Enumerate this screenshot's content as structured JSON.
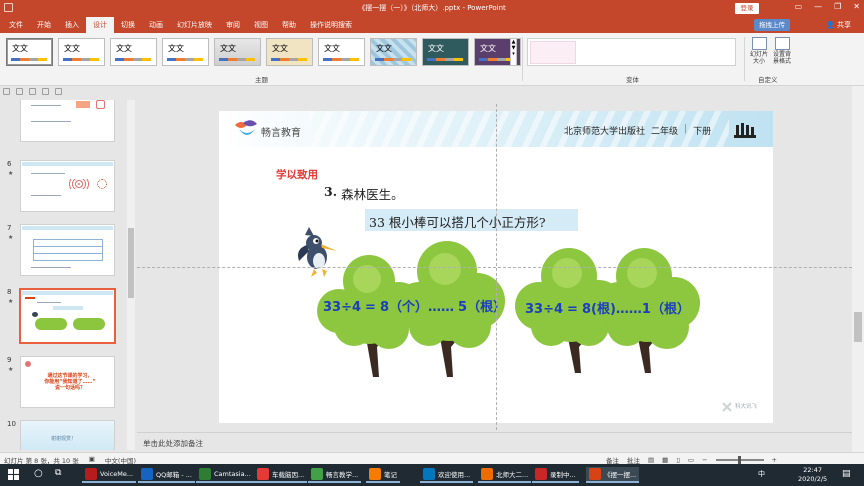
{
  "titlebar": {
    "title": "《摆一摆（一）》（北师大）.pptx - PowerPoint",
    "login": "登录"
  },
  "menu": {
    "items": [
      "文件",
      "开始",
      "插入",
      "设计",
      "切换",
      "动画",
      "幻灯片放映",
      "审阅",
      "视图",
      "帮助",
      "操作说明搜索"
    ],
    "active_index": 3,
    "upload": "拖拽上传",
    "share": "共享"
  },
  "ribbon": {
    "theme_label": "文文",
    "group_theme": "主题",
    "group_variant": "变体",
    "group_custom": "自定义",
    "slide_size": "幻灯片\n大小",
    "format_bg": "设置背\n景格式"
  },
  "slides": [
    {
      "num": "6",
      "star": "★"
    },
    {
      "num": "7",
      "star": "★"
    },
    {
      "num": "8",
      "star": "★"
    },
    {
      "num": "9",
      "star": "★"
    },
    {
      "num": "10",
      "star": ""
    }
  ],
  "thumb9_text": "通过这节课的学习，\n你能用“我知道了……”\n说一句话吗？",
  "thumb10_text": "谢谢观赏！",
  "slide": {
    "brand": "畅言教育",
    "publisher": "北京师范大学出版社",
    "grade": "二年级",
    "term": "下册",
    "section": "学以致用",
    "problem_num": "3.",
    "problem_title": "森林医生。",
    "question": "33 根小棒可以搭几个小正方形?",
    "eq1": {
      "a": "33",
      "op": "÷",
      "b": "4",
      "eq": "=",
      "q": "8",
      "qu": "（个）",
      "dots": "……",
      "r": "5",
      "ru": "（根）"
    },
    "eq2": {
      "a": "33",
      "op": "÷",
      "b": "4",
      "eq": "=",
      "q": "8",
      "qu": "(根)",
      "dots": "……",
      "r": "1",
      "ru": "（根）"
    },
    "watermark": "科大讯飞"
  },
  "notes": "单击此处添加备注",
  "status": {
    "slide_info": "幻灯片 第 8 张，共 10 张",
    "language": "中文(中国)",
    "notes_btn": "备注",
    "comments_btn": "批注"
  },
  "taskbar": {
    "items": [
      "VoiceMe...",
      "QQ邮箱 - ...",
      "Camtasia...",
      "车载脑因...",
      "畅言教学...",
      "笔记",
      "欢迎使用...",
      "北师大二...",
      "录制中...",
      "《摆一摆..."
    ],
    "time": "22:47",
    "date": "2020/2/5",
    "ime": "中"
  }
}
